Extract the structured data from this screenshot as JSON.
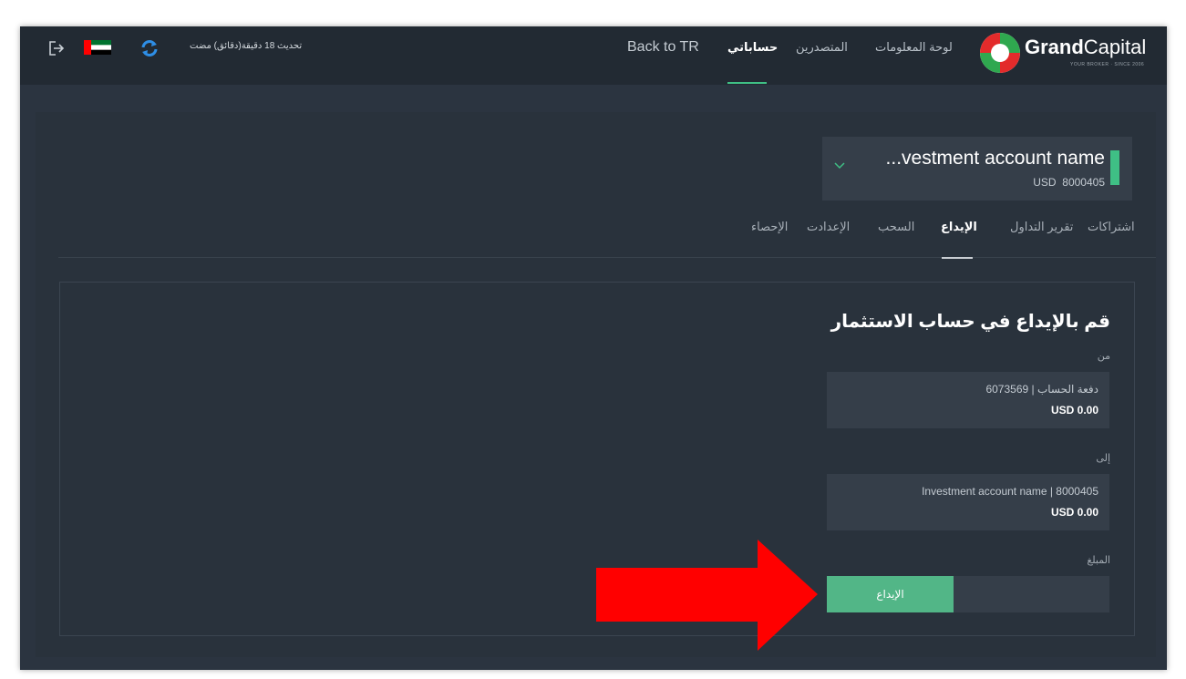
{
  "topbar": {
    "logo_bold": "Grand",
    "logo_light": "Capital",
    "logo_tagline": "YOUR BROKER · SINCE 2006",
    "nav": {
      "dashboard": "لوحة المعلومات",
      "providers": "المتصدرين",
      "my_accounts": "حساباتي",
      "back": "Back to TR"
    },
    "update_text": "تحديث 18 دقيقة(دقائق) مضت"
  },
  "account": {
    "name": "...vestment account name",
    "currency": "USD",
    "number": "8000405"
  },
  "tabs": [
    "اشتراكات",
    "تقرير التداول",
    "الإيداع",
    "السحب",
    "الإعدادت",
    "الإحصاء"
  ],
  "form": {
    "title": "قم بالإيداع في حساب الاستثمار",
    "from_label": "من",
    "from_line1": "دفعة الحساب | 6073569",
    "from_line2": "USD 0.00",
    "to_label": "إلى",
    "to_line1": "Investment account name | 8000405",
    "to_line2": "USD 0.00",
    "amount_label": "المبلغ",
    "deposit_button": "الإيداع"
  },
  "colors": {
    "accent_green": "#3fbf85",
    "button_green": "#52b687",
    "annotation_arrow": "#ff0000"
  }
}
